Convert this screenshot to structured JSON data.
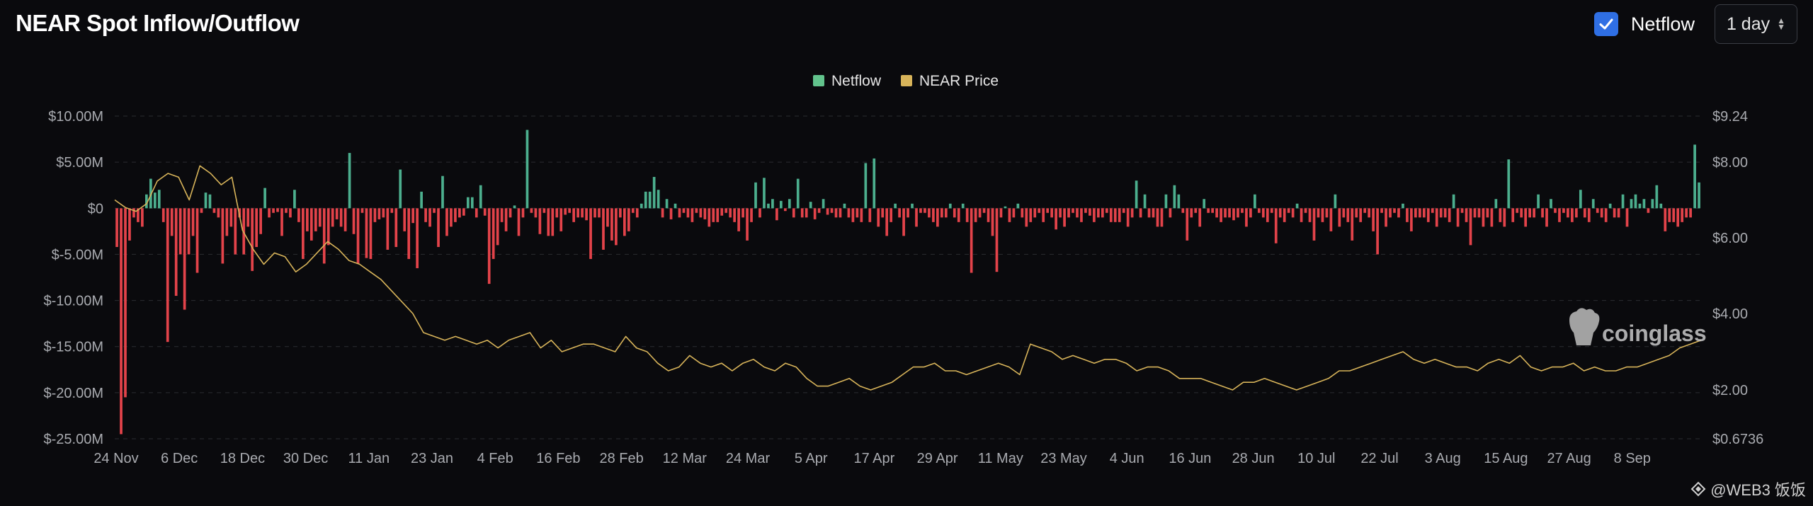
{
  "header": {
    "title": "NEAR Spot Inflow/Outflow",
    "toggle_label": "Netflow",
    "timeframe": "1 day"
  },
  "watermark": {
    "brand": "coinglass"
  },
  "footer": {
    "credit": "@WEB3 饭饭"
  },
  "colors": {
    "positive": "#4caf8e",
    "negative": "#e3434a",
    "price": "#d8b45a",
    "accent": "#2f6fe4"
  },
  "chart_data": {
    "type": "bar",
    "title": "NEAR Spot Inflow/Outflow",
    "legend": [
      {
        "name": "Netflow",
        "color": "#62c38c"
      },
      {
        "name": "NEAR Price",
        "color": "#d8b45a"
      }
    ],
    "legend_position": "top-center",
    "x_ticks": [
      "24 Nov",
      "6 Dec",
      "18 Dec",
      "30 Dec",
      "11 Jan",
      "23 Jan",
      "4 Feb",
      "16 Feb",
      "28 Feb",
      "12 Mar",
      "24 Mar",
      "5 Apr",
      "17 Apr",
      "29 Apr",
      "11 May",
      "23 May",
      "4 Jun",
      "16 Jun",
      "28 Jun",
      "10 Jul",
      "22 Jul",
      "3 Aug",
      "15 Aug",
      "27 Aug",
      "8 Sep"
    ],
    "left_axis": {
      "ticks": [
        "$10.00M",
        "$5.00M",
        "$0",
        "$-5.00M",
        "$-10.00M",
        "$-15.00M",
        "$-20.00M",
        "$-25.00M"
      ],
      "range": [
        -25,
        10
      ],
      "unit": "M"
    },
    "right_axis": {
      "ticks": [
        "$9.24",
        "$8.00",
        "$6.00",
        "$4.00",
        "$2.00",
        "$0.6736"
      ]
    },
    "grid": true,
    "series": [
      {
        "name": "Netflow",
        "unit": "$M",
        "values": [
          -4.2,
          -24.5,
          -20.5,
          -3.5,
          -1,
          -1.5,
          -2,
          1.5,
          3.2,
          1.7,
          2,
          -1.5,
          -14.5,
          -3,
          -9.5,
          -5,
          -11,
          -5,
          -3,
          -7,
          -0.5,
          1.7,
          1.5,
          -0.5,
          -1,
          -6,
          -3,
          -2,
          -5,
          -1,
          -5,
          -2,
          -6.8,
          -4.2,
          -2.8,
          2.2,
          -1,
          -0.5,
          -0.4,
          -3,
          -0.5,
          -1,
          2,
          -1.5,
          -5.5,
          -2.5,
          -3.5,
          -2.5,
          -2,
          -6,
          -4,
          -2,
          -1.2,
          -2,
          -2.5,
          6,
          -2.8,
          -6,
          -0.5,
          -5.4,
          -5.5,
          -1.5,
          -1.2,
          -1,
          -4.5,
          -0.5,
          -4.2,
          4.2,
          -2.5,
          -5.5,
          -1.6,
          -6.5,
          1.8,
          -1.5,
          -2,
          -0.5,
          -4.2,
          3.5,
          -3,
          -2,
          -1.5,
          -1,
          -0.8,
          1.2,
          1.2,
          -1,
          2.5,
          -0.8,
          -8.2,
          -5.5,
          -4,
          -1.5,
          -2.5,
          -1,
          0.3,
          -3,
          -1,
          8.5,
          -0.5,
          -1,
          -2.8,
          -0.5,
          -3,
          -3,
          -1,
          -2.5,
          -0.7,
          -0.5,
          -1.5,
          -1,
          -1,
          -1.3,
          -5.5,
          -1,
          -1,
          -4.5,
          -2,
          -3.5,
          -4,
          -1,
          -3,
          -2.5,
          -0.5,
          -1,
          0.5,
          1.8,
          1.8,
          3.4,
          2,
          -1,
          1,
          -1.2,
          0.5,
          -1,
          -0.5,
          -1,
          -1.5,
          -0.5,
          -1,
          -1.2,
          -2,
          -1.5,
          -1.5,
          -0.8,
          -0.5,
          -1,
          -1.5,
          -2.5,
          -1,
          -3.5,
          -1.5,
          2.8,
          -1,
          3.3,
          0.5,
          1,
          -1.3,
          0.8,
          -0.3,
          1,
          -1,
          3.2,
          -1,
          -1,
          0.7,
          -1.2,
          -0.5,
          1,
          -0.7,
          -0.5,
          -1,
          -1,
          0.5,
          -1,
          -1.5,
          -1,
          -1.5,
          4.9,
          -1.5,
          5.4,
          -2,
          -1,
          -3,
          -1.5,
          0.5,
          -1,
          -3,
          -1,
          0.5,
          -2,
          -0.5,
          -0.5,
          -1,
          -1.5,
          -2,
          -1,
          -1,
          0.5,
          -1,
          -1.5,
          0.5,
          -1.5,
          -7,
          -1.5,
          -1,
          -0.5,
          -1.5,
          -3,
          -6.9,
          -1,
          0.2,
          -1.5,
          -1,
          0.5,
          -1,
          -2,
          -1.5,
          -1,
          -0.5,
          -1.5,
          -0.5,
          -1,
          -2.3,
          -1,
          -2,
          -1,
          -0.5,
          -1,
          -1.5,
          -0.5,
          -0.8,
          -1.5,
          -1,
          -1,
          -0.5,
          -1.5,
          -1.5,
          -1.5,
          -0.5,
          -2,
          -1,
          3,
          -1,
          1.5,
          -1,
          -1,
          -2,
          -2,
          1.5,
          -1,
          2.5,
          1.5,
          -0.5,
          -3.5,
          -1,
          -0.5,
          -2,
          1,
          -0.5,
          -0.5,
          -1,
          -1.5,
          -1,
          -1,
          -1.3,
          -1,
          -0.5,
          -2,
          -1,
          1.5,
          -0.5,
          -1,
          -1.5,
          -0.5,
          -3.8,
          -1,
          -1.5,
          -0.5,
          -1,
          0.5,
          -1.5,
          -0.5,
          -1.5,
          -3.5,
          -1,
          -1.5,
          -1,
          -2.5,
          1.5,
          -2,
          -1,
          -1.5,
          -3.5,
          -1,
          -1.5,
          -0.5,
          -1,
          -2.5,
          -5,
          -0.5,
          -2,
          -1,
          -0.5,
          -1,
          0.5,
          -1.5,
          -2.5,
          -1,
          -1,
          -1,
          -1.5,
          -0.5,
          -2,
          -1,
          -1,
          -1.5,
          1.5,
          -2,
          -0.5,
          -1.5,
          -4,
          -1,
          -1,
          -2,
          -1,
          -2,
          1,
          -1.5,
          -2,
          5.3,
          -1.5,
          -0.5,
          -1,
          -2,
          -1,
          -1,
          1.5,
          -1,
          -2,
          1,
          -0.5,
          -1.5,
          -0.5,
          -1,
          -1.5,
          -1,
          2,
          -1,
          -1.5,
          1,
          -0.5,
          -1,
          -1.5,
          0.5,
          -1,
          -1,
          1.5,
          -2,
          1,
          1.5,
          0.5,
          1,
          -0.5,
          1,
          2.5,
          0.5,
          -2.5,
          -1.5,
          -1.5,
          -2,
          -1.5,
          -1,
          -1,
          6.9,
          2.8
        ]
      },
      {
        "name": "NEAR Price",
        "unit": "$",
        "values": [
          7.0,
          6.8,
          6.7,
          6.9,
          7.5,
          7.7,
          7.6,
          7.0,
          7.9,
          7.7,
          7.4,
          7.6,
          6.2,
          5.7,
          5.3,
          5.6,
          5.5,
          5.1,
          5.3,
          5.6,
          5.9,
          5.7,
          5.4,
          5.3,
          5.1,
          4.9,
          4.6,
          4.3,
          4.0,
          3.5,
          3.4,
          3.3,
          3.4,
          3.3,
          3.2,
          3.3,
          3.1,
          3.3,
          3.4,
          3.5,
          3.1,
          3.3,
          3.0,
          3.1,
          3.2,
          3.2,
          3.1,
          3.0,
          3.4,
          3.1,
          3.0,
          2.7,
          2.5,
          2.6,
          2.9,
          2.7,
          2.6,
          2.7,
          2.5,
          2.7,
          2.8,
          2.6,
          2.5,
          2.7,
          2.6,
          2.3,
          2.1,
          2.1,
          2.2,
          2.3,
          2.1,
          2.0,
          2.1,
          2.2,
          2.4,
          2.6,
          2.6,
          2.7,
          2.5,
          2.5,
          2.4,
          2.5,
          2.6,
          2.7,
          2.6,
          2.4,
          3.2,
          3.1,
          3.0,
          2.8,
          2.9,
          2.8,
          2.7,
          2.8,
          2.8,
          2.7,
          2.5,
          2.6,
          2.6,
          2.5,
          2.3,
          2.3,
          2.3,
          2.2,
          2.1,
          2.0,
          2.2,
          2.2,
          2.3,
          2.2,
          2.1,
          2.0,
          2.1,
          2.2,
          2.3,
          2.5,
          2.5,
          2.6,
          2.7,
          2.8,
          2.9,
          3.0,
          2.8,
          2.7,
          2.8,
          2.7,
          2.6,
          2.6,
          2.5,
          2.7,
          2.8,
          2.7,
          2.9,
          2.6,
          2.5,
          2.6,
          2.6,
          2.7,
          2.5,
          2.6,
          2.5,
          2.5,
          2.6,
          2.6,
          2.7,
          2.8,
          2.9,
          3.1,
          3.2,
          3.3
        ]
      }
    ]
  }
}
